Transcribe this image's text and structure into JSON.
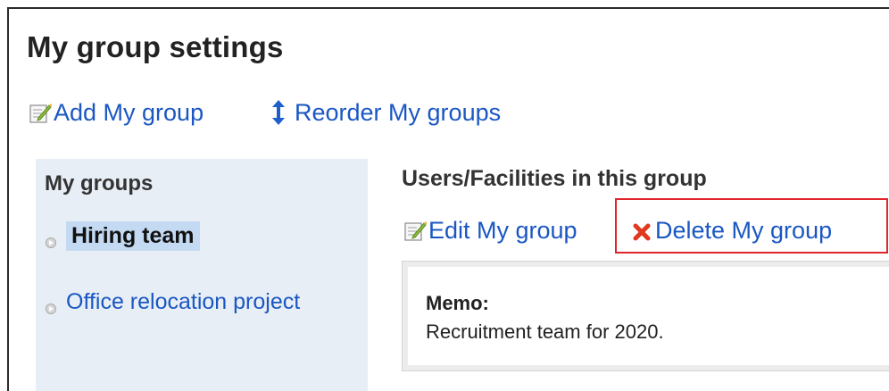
{
  "page": {
    "title": "My group settings"
  },
  "toolbar": {
    "add_label": "Add My group",
    "reorder_label": "Reorder My groups"
  },
  "sidebar": {
    "heading": "My groups",
    "items": [
      {
        "label": "Hiring team",
        "selected": true
      },
      {
        "label": "Office relocation project",
        "selected": false
      }
    ]
  },
  "panel": {
    "heading": "Users/Facilities in this group",
    "edit_label": "Edit My group",
    "delete_label": "Delete My group",
    "memo_label": "Memo:",
    "memo_text": "Recruitment team for 2020."
  },
  "colors": {
    "link": "#1a57c2",
    "highlight_border": "#e0262d",
    "sidebar_bg": "#e8eef6",
    "selected_bg": "#c4daf2",
    "delete_icon": "#e03a1e"
  },
  "icons": [
    "edit-icon",
    "reorder-arrows-icon",
    "bullet-icon",
    "delete-x-icon"
  ]
}
